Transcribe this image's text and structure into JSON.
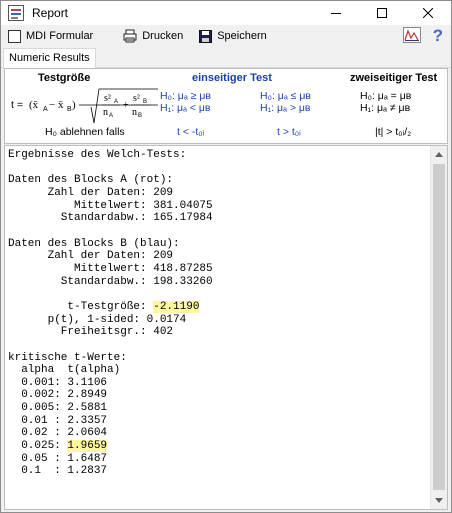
{
  "window": {
    "title": "Report"
  },
  "toolbar": {
    "mdi_label": "MDI Formular",
    "print_label": "Drucken",
    "save_label": "Speichern",
    "help_label": "?"
  },
  "tabs": [
    {
      "label": "Numeric Results"
    }
  ],
  "formula": {
    "h_test": "Testgröße",
    "h_one": "einseitiger Test",
    "h_two": "zweiseitiger Test",
    "t_prefix": "t =",
    "one_col1_h0": "H₀: μₐ ≥ μʙ",
    "one_col1_h1": "H₁: μₐ < μʙ",
    "one_col2_h0": "H₀: μₐ ≤ μʙ",
    "one_col2_h1": "H₁: μₐ > μʙ",
    "two_h0": "H₀: μₐ = μʙ",
    "two_h1": "H₁: μₐ ≠ μʙ",
    "reject_label": "H₀ ablehnen  falls",
    "reject_1": "t < -t₀ᵢ",
    "reject_2": "t > t₀ᵢ",
    "reject_3": "|t| > t₀ᵢ/₂"
  },
  "output": {
    "line_1": "Ergebnisse des Welch-Tests:",
    "line_2": "",
    "line_3": "Daten des Blocks A (rot):",
    "line_4": "      Zahl der Daten: 209",
    "line_5": "          Mittelwert: 381.04075",
    "line_6": "        Standardabw.: 165.17984",
    "line_7": "",
    "line_8": "Daten des Blocks B (blau):",
    "line_9": "      Zahl der Daten: 209",
    "line_10": "          Mittelwert: 418.87285",
    "line_11": "        Standardabw.: 198.33260",
    "line_12": "",
    "line_13_a": "         t-Testgröße: ",
    "line_13_b": "-2.1190",
    "line_14": "      p(t), 1-sided: 0.0174",
    "line_15": "        Freiheitsgr.: 402",
    "line_16": "",
    "line_17": "kritische t-Werte:",
    "line_18": "  alpha  t(alpha)",
    "line_19": "  0.001: 3.1106",
    "line_20": "  0.002: 2.8949",
    "line_21": "  0.005: 2.5881",
    "line_22": "  0.01 : 2.3357",
    "line_23": "  0.02 : 2.0604",
    "line_24_a": "  0.025: ",
    "line_24_b": "1.9659",
    "line_25": "  0.05 : 1.6487",
    "line_26": "  0.1  : 1.2837"
  },
  "colors": {
    "highlight": "#fff7a0",
    "formula_blue": "#1a3fb8",
    "help_blue": "#3c6cc8"
  }
}
